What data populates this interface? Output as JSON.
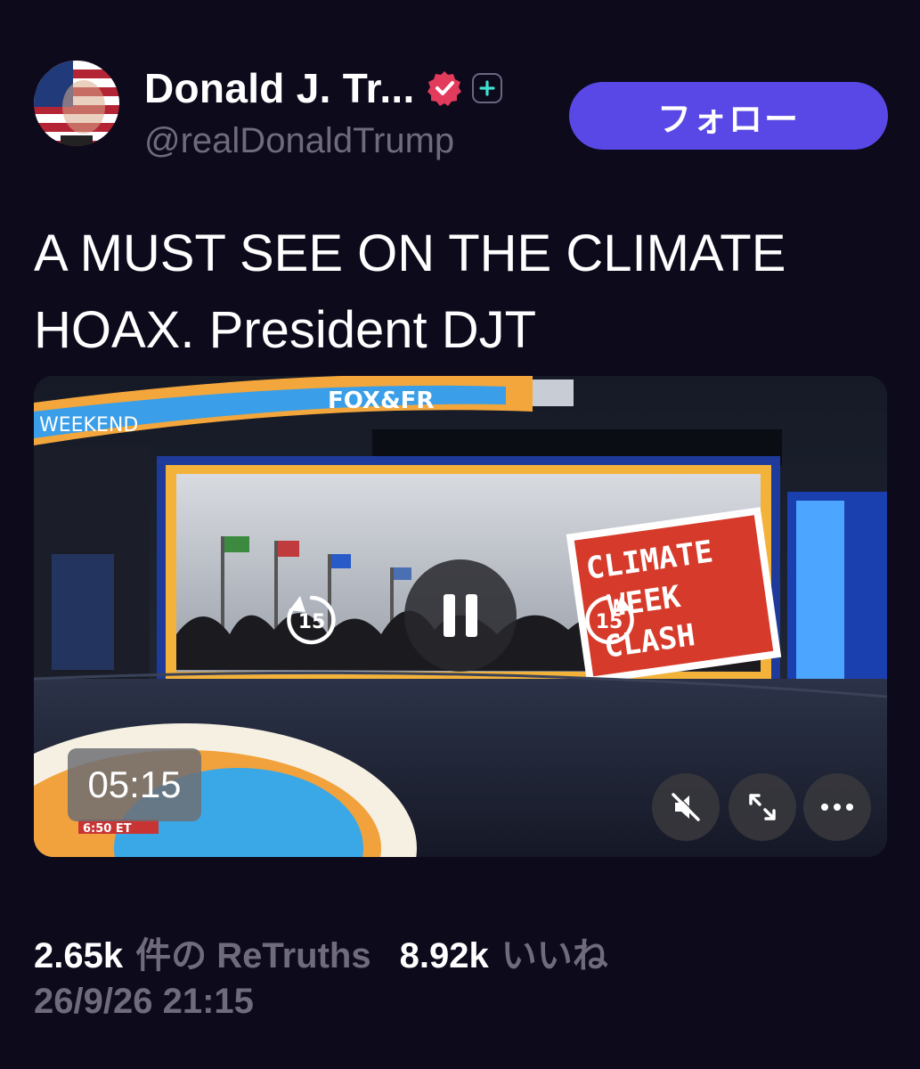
{
  "author": {
    "display_name": "Donald J. Tr...",
    "handle": "@realDonaldTrump",
    "verified_icon": "verified-badge-icon",
    "plus_icon": "plus-icon"
  },
  "follow_button": {
    "label": "フォロー"
  },
  "post": {
    "text": "A MUST SEE ON THE CLIMATE HOAX. President DJT"
  },
  "video": {
    "duration": "05:15",
    "skip_back_seconds": "15",
    "skip_forward_seconds": "15",
    "channel_logo_text": "FOX&FR",
    "ticker_text": "WEEKEND",
    "screen_sign_text": [
      "CLIMATE",
      "WEEK",
      "CLASH"
    ],
    "lower_third_time": "6:50 ET",
    "controls": [
      "replay-15-icon",
      "pause-icon",
      "forward-15-icon",
      "mute-icon",
      "fullscreen-icon",
      "more-icon"
    ]
  },
  "stats": {
    "retruths_count": "2.65k",
    "retruths_label": "件の ReTruths",
    "likes_count": "8.92k",
    "likes_label": "いいね"
  },
  "posted_at": "26/9/26 21:15",
  "colors": {
    "background": "#0d0a1c",
    "accent": "#5a48e6",
    "muted_text": "#6f6b7d"
  }
}
